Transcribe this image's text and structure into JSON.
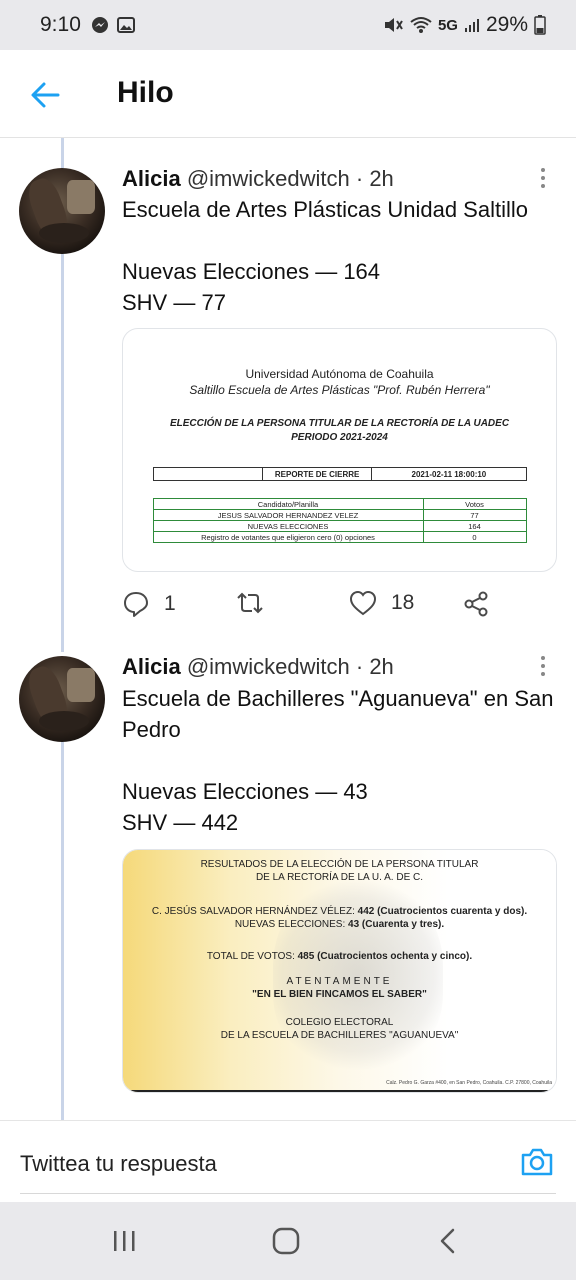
{
  "status": {
    "time": "9:10",
    "network": "5G",
    "battery": "29%"
  },
  "header": {
    "title": "Hilo"
  },
  "tweets": [
    {
      "name": "Alicia",
      "handle": "@imwickedwitch",
      "age": "· 2h",
      "text": "Escuela de Artes Plásticas Unidad Saltillo\n\nNuevas Elecciones — 164\nSHV — 77",
      "replies": "1",
      "retweets": "",
      "likes": "18",
      "doc": {
        "line1": "Universidad Autónoma de Coahuila",
        "line2": "Saltillo Escuela de Artes Plásticas \"Prof. Rubén Herrera\"",
        "line3": "ELECCIÓN DE LA PERSONA TITULAR DE LA RECTORÍA DE LA UADEC",
        "line4": "PERIODO 2021-2024",
        "report_label": "REPORTE DE CIERRE",
        "report_date": "2021-02-11 18:00:10",
        "table_headers": [
          "Candidato/Planilla",
          "Votos"
        ],
        "rows": [
          [
            "JESUS SALVADOR HERNANDEZ VELEZ",
            "77"
          ],
          [
            "NUEVAS ELECCIONES",
            "164"
          ],
          [
            "Registro de votantes que eligieron cero (0) opciones",
            "0"
          ]
        ]
      }
    },
    {
      "name": "Alicia",
      "handle": "@imwickedwitch",
      "age": "· 2h",
      "text": "Escuela de Bachilleres \"Aguanueva\" en San Pedro\n\nNuevas Elecciones — 43\nSHV — 442",
      "doc": {
        "l1": "RESULTADOS DE LA ELECCIÓN DE LA PERSONA TITULAR",
        "l2": "DE LA RECTORÍA DE LA U. A. DE C.",
        "c1a": "C. JESÚS SALVADOR HERNÁNDEZ VÉLEZ:",
        "c1b": "442 (Cuatrocientos cuarenta y dos).",
        "c2a": "NUEVAS ELECCIONES:",
        "c2b": "43 (Cuarenta y tres).",
        "t1a": "TOTAL DE VOTOS:",
        "t1b": "485 (Cuatrocientos ochenta y cinco).",
        "at": "ATENTAMENTE",
        "motto": "\"EN EL BIEN FINCAMOS EL SABER\"",
        "col1": "COLEGIO ELECTORAL",
        "col2": "DE LA ESCUELA DE BACHILLERES \"AGUANUEVA\"",
        "addr": "Calz. Pedro G. Garza #400, en San Pedro, Coahuila. C.P. 27800, Coahuila"
      }
    }
  ],
  "reply": {
    "placeholder": "Twittea tu respuesta"
  },
  "colors": {
    "accent": "#1da1f2",
    "thread_line": "#c9d4e8",
    "table_green": "#2e8b3a"
  }
}
